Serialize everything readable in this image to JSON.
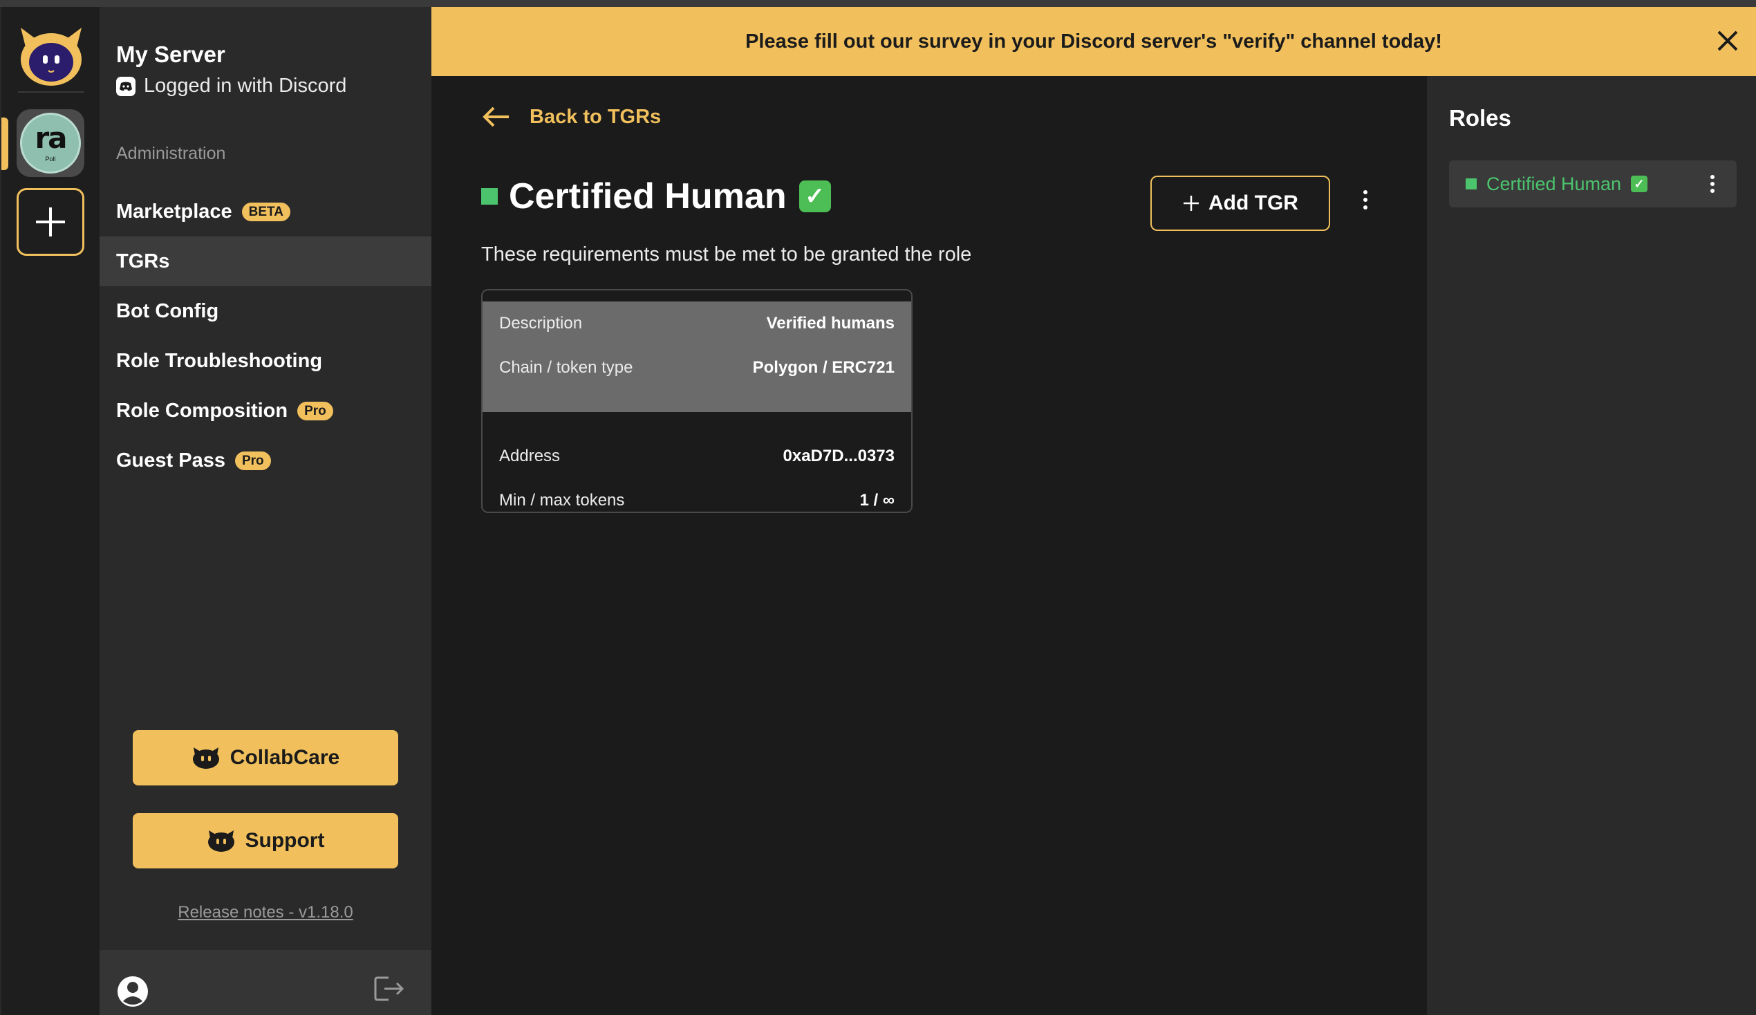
{
  "banner": {
    "text": "Please fill out our survey in your Discord server's \"verify\" channel today!"
  },
  "rail": {
    "server_initials": "ra",
    "server_sub": "Poll"
  },
  "sidebar": {
    "server_name": "My Server",
    "login_status": "Logged in with Discord",
    "section_label": "Administration",
    "items": [
      {
        "label": "Marketplace",
        "tag": "BETA"
      },
      {
        "label": "TGRs",
        "tag": ""
      },
      {
        "label": "Bot Config",
        "tag": ""
      },
      {
        "label": "Role Troubleshooting",
        "tag": ""
      },
      {
        "label": "Role Composition",
        "tag": "Pro"
      },
      {
        "label": "Guest Pass",
        "tag": "Pro"
      }
    ],
    "collabcare_label": "CollabCare",
    "support_label": "Support",
    "release_notes": "Release notes - v1.18.0"
  },
  "main": {
    "back_label": "Back to TGRs",
    "role_title": "Certified Human",
    "role_emoji": "✓",
    "add_button_label": "Add TGR",
    "requirements_text": "These requirements must be met to be granted the role",
    "card": {
      "description_label": "Description",
      "description_value": "Verified humans",
      "chain_label": "Chain / token type",
      "chain_value": "Polygon / ERC721",
      "address_label": "Address",
      "address_value": "0xaD7D...0373",
      "tokens_label": "Min / max tokens",
      "tokens_value": "1 / ∞"
    }
  },
  "roles_panel": {
    "title": "Roles",
    "items": [
      {
        "name": "Certified Human",
        "emoji": "✓"
      }
    ]
  },
  "colors": {
    "accent": "#f1c05d",
    "role_green": "#4cc46e",
    "background": "#1b1b1b",
    "sidebar": "#2a2a2a"
  }
}
